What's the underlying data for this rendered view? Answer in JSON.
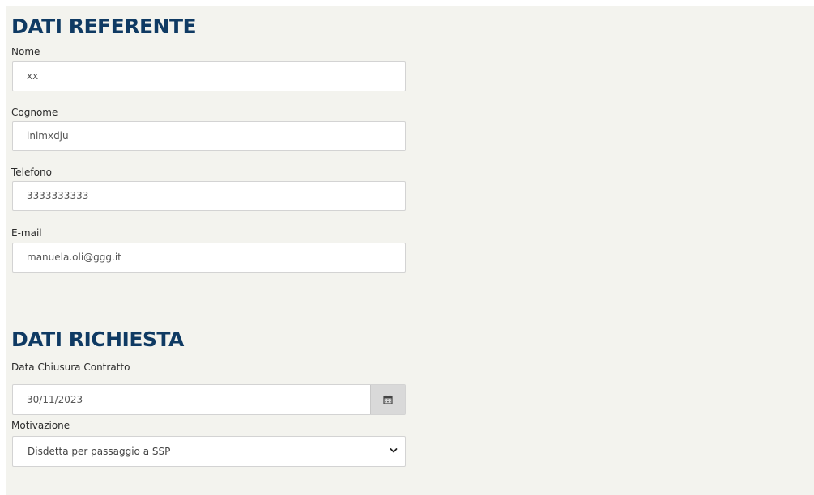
{
  "referente": {
    "title": "DATI REFERENTE",
    "nome": {
      "label": "Nome",
      "value": "xx"
    },
    "cognome": {
      "label": "Cognome",
      "value": "inlmxdju"
    },
    "telefono": {
      "label": "Telefono",
      "value": "3333333333"
    },
    "email": {
      "label": "E-mail",
      "value": "manuela.oli@ggg.it"
    }
  },
  "richiesta": {
    "title": "DATI RICHIESTA",
    "data_chiusura": {
      "label": "Data Chiusura Contratto",
      "value": "30/11/2023",
      "icon": "calendar-icon"
    },
    "motivazione": {
      "label": "Motivazione",
      "selected": "Disdetta per passaggio a SSP",
      "icon": "chevron-down-icon"
    }
  },
  "colors": {
    "heading": "#0f3a63",
    "panel_background": "#f3f3ee",
    "field_border": "#d3d3d3",
    "addon_background": "#d9d9d9"
  }
}
